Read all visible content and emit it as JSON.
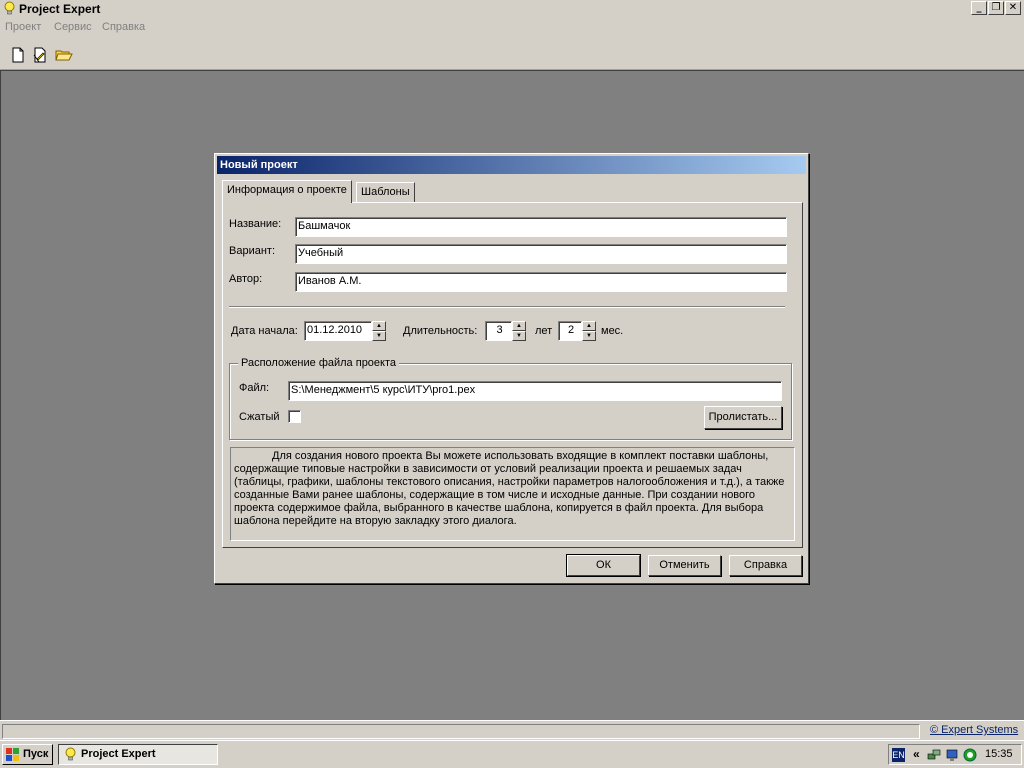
{
  "window": {
    "title": "Project Expert",
    "controls": {
      "minimize": "_",
      "restore": "❐",
      "close": "✕"
    }
  },
  "menu": [
    {
      "label": "Проект"
    },
    {
      "label": "Сервис"
    },
    {
      "label": "Справка"
    }
  ],
  "toolbar": {
    "icons": [
      "new-document-icon",
      "new-from-template-icon",
      "open-folder-icon"
    ]
  },
  "dialog": {
    "title": "Новый проект",
    "tabs": [
      {
        "label": "Информация о проекте",
        "active": true
      },
      {
        "label": "Шаблоны",
        "active": false
      }
    ],
    "fields": {
      "name": {
        "label": "Название:",
        "value": "Башмачок"
      },
      "variant": {
        "label": "Вариант:",
        "value": "Учебный"
      },
      "author": {
        "label": "Автор:",
        "value": "Иванов А.М."
      }
    },
    "start_date": {
      "label": "Дата начала:",
      "value": "01.12.2010"
    },
    "duration": {
      "label": "Длительность:",
      "years": "3",
      "years_unit": "лет",
      "months": "2",
      "months_unit": "мес."
    },
    "file_group": {
      "title": "Расположение файла проекта",
      "file_label": "Файл:",
      "file_value": "S:\\Менеджмент\\5 курс\\ИТУ\\pro1.pex",
      "compressed_label": "Сжатый",
      "compressed_checked": false,
      "browse_label": "Пролистать..."
    },
    "info_text": "Для создания нового проекта Вы можете использовать входящие в комплект поставки шаблоны, содержащие типовые настройки в зависимости от условий реализации проекта и решаемых задач (таблицы, графики, шаблоны текстового описания, настройки параметров налогообложения и т.д.), а также созданные Вами ранее шаблоны, содержащие в том числе и исходные данные. При создании нового проекта содержимое файла, выбранного в качестве шаблона, копируется в файл проекта. Для выбора шаблона перейдите на вторую закладку этого диалога.",
    "buttons": {
      "ok": "ОК",
      "cancel": "Отменить",
      "help": "Справка"
    }
  },
  "statusbar": {
    "link": "© Expert Systems"
  },
  "taskbar": {
    "start_label": "Пуск",
    "task_label": "Project Expert",
    "lang": "EN",
    "arrows": "«",
    "clock": "15:35"
  },
  "colors": {
    "title_gradient_start": "#0a246a",
    "title_gradient_end": "#a6caf0",
    "face": "#d4d0c8",
    "workspace": "#808080"
  }
}
